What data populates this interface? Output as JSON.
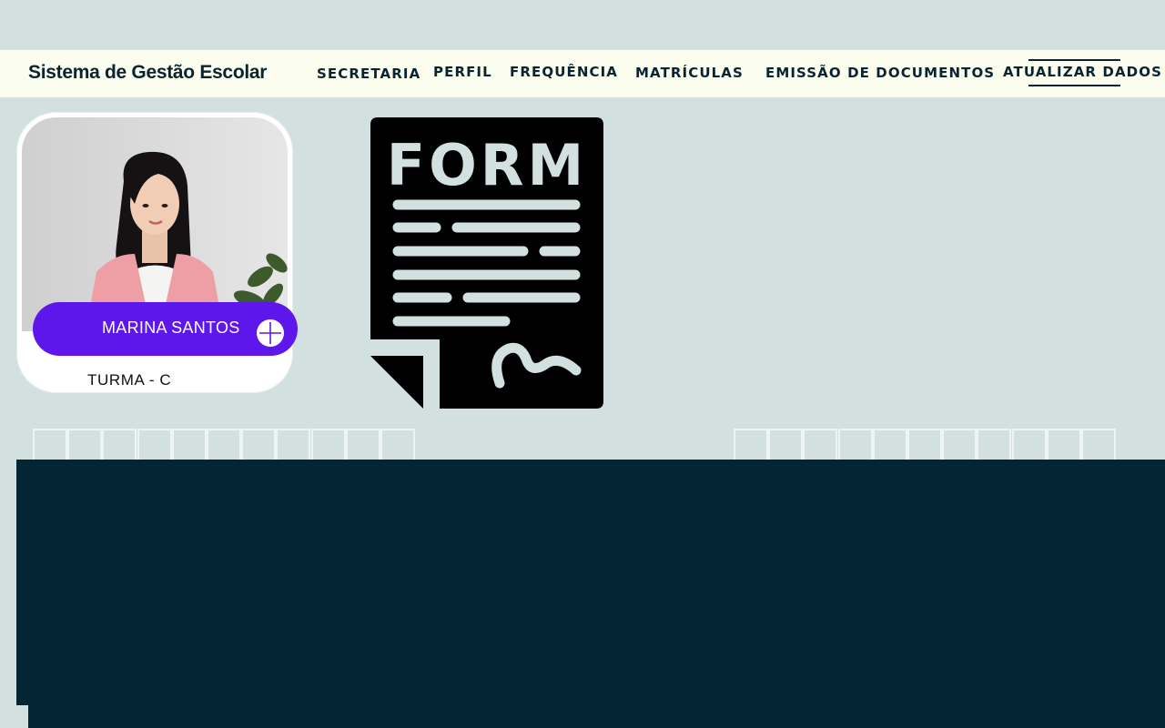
{
  "app": {
    "title": "Sistema de Gestão Escolar"
  },
  "nav": {
    "items": [
      {
        "label": "SECRETARIA"
      },
      {
        "label": "PERFIL"
      },
      {
        "label": "FREQUÊNCIA"
      },
      {
        "label": "MATRÍCULAS"
      },
      {
        "label": "EMISSÃO DE DOCUMENTOS"
      },
      {
        "label": "ATUALIZAR DADOS"
      }
    ],
    "active": "ATUALIZAR DADOS"
  },
  "profile": {
    "name": "MARINA SANTOS",
    "class": "TURMA - C"
  },
  "form_icon": {
    "label": "FORM"
  },
  "colors": {
    "background": "#d2e0e0",
    "navbar": "#fbfdee",
    "accent": "#5d17eb",
    "dark_panel": "#042533",
    "text_dark": "#0a2330"
  }
}
